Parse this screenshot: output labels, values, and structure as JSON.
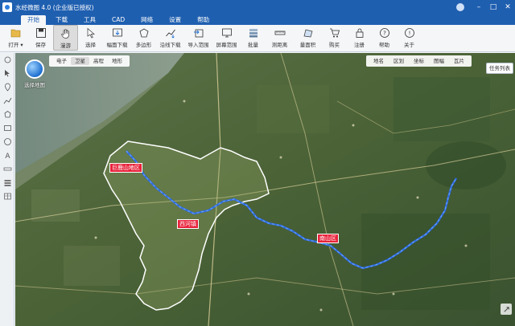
{
  "window": {
    "title": "水经微图 4.0 (企业版已授权)",
    "user": "",
    "controls": [
      "–",
      "□",
      "✕"
    ]
  },
  "menu": {
    "items": [
      {
        "label": "开始",
        "active": true
      },
      {
        "label": "下载",
        "active": false
      },
      {
        "label": "工具",
        "active": false
      },
      {
        "label": "CAD",
        "active": false
      },
      {
        "label": "网络",
        "active": false
      },
      {
        "label": "设置",
        "active": false
      },
      {
        "label": "帮助",
        "active": false
      }
    ]
  },
  "toolbar": {
    "items": [
      {
        "label": "打开 ▾",
        "icon": "folder-open-icon"
      },
      {
        "label": "保存",
        "icon": "save-icon"
      },
      {
        "label": "漫游",
        "icon": "hand-icon",
        "active": true
      },
      {
        "label": "选择",
        "icon": "cursor-icon"
      },
      {
        "label": "幅面下载",
        "icon": "frame-download-icon"
      },
      {
        "label": "多边形",
        "icon": "polygon-icon"
      },
      {
        "label": "沿线下载",
        "icon": "line-download-icon"
      },
      {
        "label": "导入范围",
        "icon": "import-range-icon"
      },
      {
        "label": "屏幕范围",
        "icon": "screen-range-icon"
      },
      {
        "label": "批量",
        "icon": "batch-icon"
      },
      {
        "label": "测距离",
        "icon": "ruler-icon"
      },
      {
        "label": "量面积",
        "icon": "area-icon"
      },
      {
        "label": "购买",
        "icon": "cart-icon"
      },
      {
        "label": "注册",
        "icon": "lock-icon"
      },
      {
        "label": "帮助",
        "icon": "help-icon"
      },
      {
        "label": "关于",
        "icon": "info-icon"
      }
    ]
  },
  "map": {
    "globe_label": "选择地图",
    "map_types": [
      {
        "label": "电子",
        "active": false
      },
      {
        "label": "卫星",
        "active": true
      },
      {
        "label": "高程",
        "active": false
      },
      {
        "label": "地形",
        "active": false
      }
    ],
    "region_tabs": [
      "地名",
      "区划",
      "坐标",
      "图幅",
      "瓦片"
    ],
    "task_list_label": "任务列表",
    "city_labels": [
      {
        "text": "巨鹿山地区"
      },
      {
        "text": "西河镇"
      },
      {
        "text": "南山区"
      }
    ],
    "colors": {
      "satellite_base": "#4e6a3a",
      "boundary": "#ffffff",
      "route": "#2f6fe3",
      "label_bg": "#e8223a"
    }
  }
}
